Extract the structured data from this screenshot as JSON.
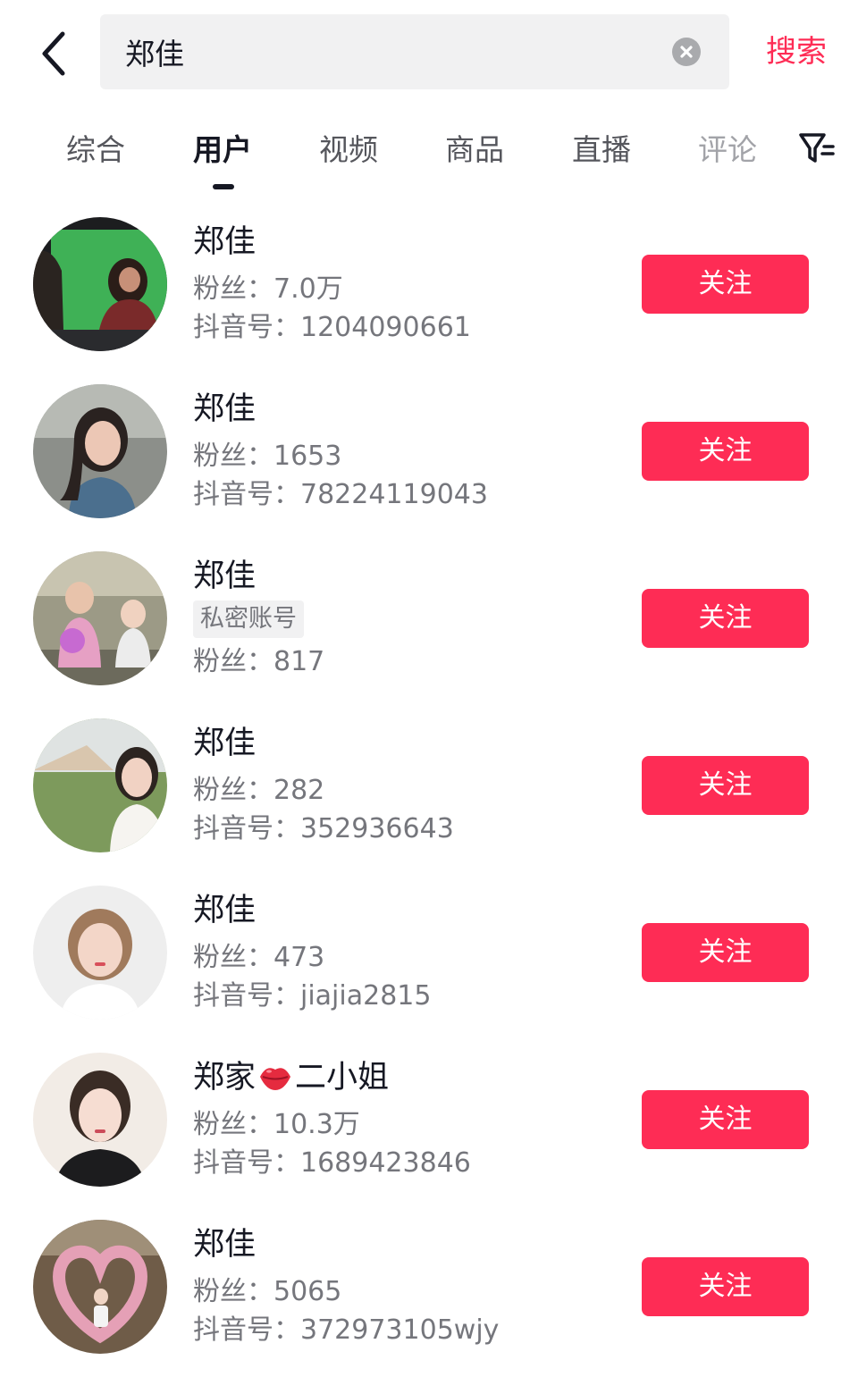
{
  "search": {
    "query": "郑佳",
    "button_label": "搜索"
  },
  "tabs": [
    {
      "label": "综合",
      "active": false
    },
    {
      "label": "用户",
      "active": true
    },
    {
      "label": "视频",
      "active": false
    },
    {
      "label": "商品",
      "active": false
    },
    {
      "label": "直播",
      "active": false
    },
    {
      "label": "评论",
      "active": false
    }
  ],
  "colors": {
    "accent": "#fe2c55",
    "text_primary": "#161823",
    "text_secondary": "#75767c",
    "search_bg": "#f1f1f2"
  },
  "icons": {
    "back": "chevron-left-icon",
    "clear": "clear-circle-icon",
    "filter": "filter-icon",
    "lips": "lips-emoji-icon"
  },
  "users": [
    {
      "name": "郑佳",
      "fans_label": "粉丝：",
      "fans": "7.0万",
      "id_label": "抖音号：",
      "douyin_id": "1204090661",
      "follow_label": "关注"
    },
    {
      "name": "郑佳",
      "fans_label": "粉丝：",
      "fans": "1653",
      "id_label": "抖音号：",
      "douyin_id": "78224119043",
      "follow_label": "关注"
    },
    {
      "name": "郑佳",
      "badge": "私密账号",
      "fans_label": "粉丝：",
      "fans": "817",
      "follow_label": "关注"
    },
    {
      "name": "郑佳",
      "fans_label": "粉丝：",
      "fans": "282",
      "id_label": "抖音号：",
      "douyin_id": "352936643",
      "follow_label": "关注"
    },
    {
      "name": "郑佳",
      "fans_label": "粉丝：",
      "fans": "473",
      "id_label": "抖音号：",
      "douyin_id": "jiajia2815",
      "follow_label": "关注"
    },
    {
      "name_prefix": "郑家",
      "name_suffix": "二小姐",
      "fans_label": "粉丝：",
      "fans": "10.3万",
      "id_label": "抖音号：",
      "douyin_id": "1689423846",
      "follow_label": "关注"
    },
    {
      "name": "郑佳",
      "fans_label": "粉丝：",
      "fans": "5065",
      "id_label": "抖音号：",
      "douyin_id": "372973105wjy",
      "follow_label": "关注"
    }
  ]
}
